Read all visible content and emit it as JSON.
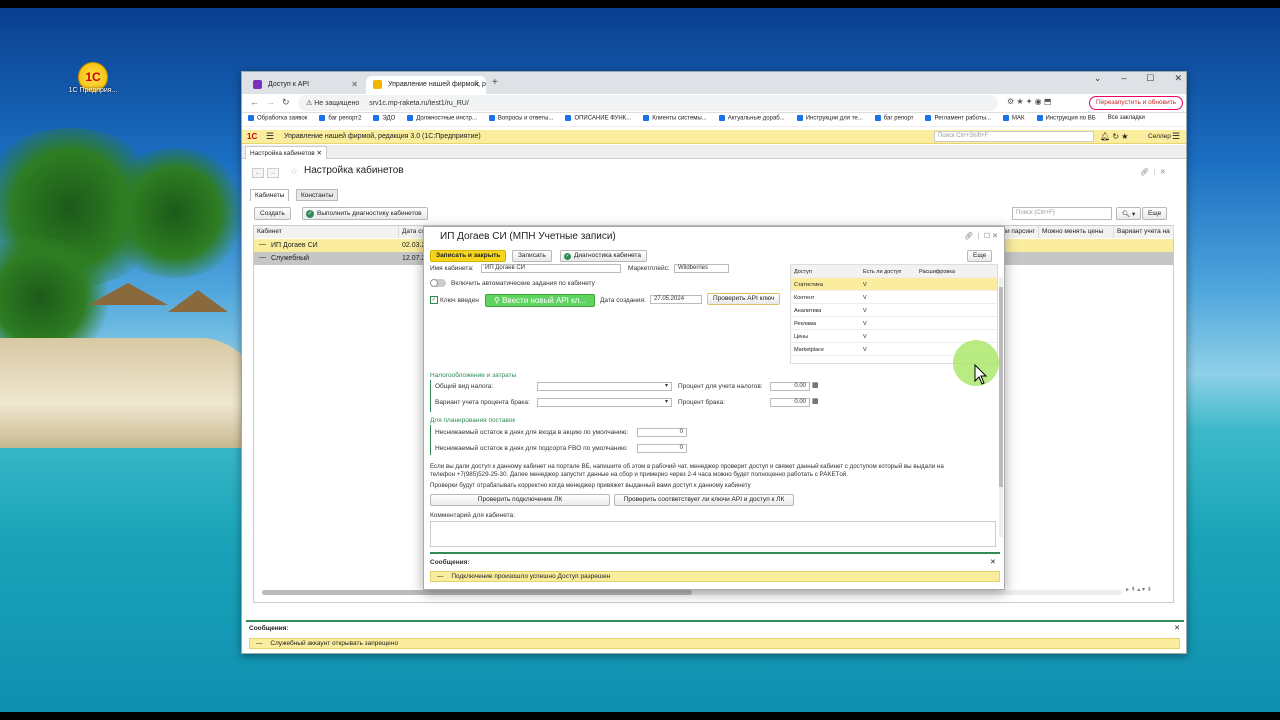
{
  "desktop": {
    "icon_label": "1С Предприя..."
  },
  "browser": {
    "tabs": [
      {
        "label": "Доступ к API"
      },
      {
        "label": "Управление нашей фирмой, р"
      }
    ],
    "url": {
      "security": "Не защищено",
      "address": "srv1c.mp-raketa.ru/test1/ru_RU/"
    },
    "restart_label": "Перезапустить и обновить",
    "bookmarks": [
      "Обработка заявок",
      "баг репорт2",
      "ЭДО",
      "Должностные инстр...",
      "Вопросы и ответы...",
      "ОПИСАНИЕ ФУНК...",
      "Клиенты системы...",
      "Актуальные дораб...",
      "Инструкции для те...",
      "баг репорт",
      "Регламент работы...",
      "МАК",
      "Инструкция по ВБ"
    ],
    "all_bookmarks": "Все закладки"
  },
  "app": {
    "title": "Управление нашей фирмой, редакция 3.0  (1С:Предприятие)",
    "search_placeholder": "Поиск Ctrl+Shift+F",
    "user": "Селлер",
    "open_tab": "Настройка кабинетов",
    "page_title": "Настройка кабинетов",
    "tabs": [
      "Кабинеты",
      "Константы"
    ],
    "create_label": "Создать",
    "diag_label": "Выполнить диагностику кабинетов",
    "search_field": "Поиск (Ctrl+F)",
    "more_label": "Еще",
    "grid": {
      "headers": [
        "Кабинет",
        "Дата со",
        "ли парсинг",
        "Можно менять цены",
        "Вариант учета на"
      ],
      "rows": [
        {
          "name": "ИП Догаев СИ",
          "date": "02.03.2"
        },
        {
          "name": "Служебный",
          "date": "12.07.2"
        }
      ]
    },
    "messages_title": "Сообщения:",
    "message": "Служебный аккаунт открывать запрещено"
  },
  "dialog": {
    "title": "ИП Догаев СИ (МПН Учетные записи)",
    "save_close": "Записать и закрыть",
    "save": "Записать",
    "diag": "Диагностика кабинета",
    "more": "Еще",
    "name_label": "Имя кабинета:",
    "name_value": "ИП Догаев СИ",
    "market_label": "Маркетплейс:",
    "market_value": "Wildberries",
    "auto_tasks": "Включить автоматические задания по кабинету",
    "key_entered": "Ключ введен",
    "new_key": "Ввести новый API кл...",
    "created_label": "Дата создания:",
    "created_value": "27.05.2024",
    "check_key": "Проверить API ключ",
    "access_table": {
      "headers": [
        "Доступ",
        "Есть ли доступ",
        "Расшифровка"
      ],
      "rows": [
        {
          "name": "Статистика",
          "v": "V"
        },
        {
          "name": "Контент",
          "v": "V"
        },
        {
          "name": "Аналитика",
          "v": "V"
        },
        {
          "name": "Реклама",
          "v": "V"
        },
        {
          "name": "Цены",
          "v": "V"
        },
        {
          "name": "Marketplace",
          "v": "V"
        }
      ]
    },
    "tax_section": "Налогообложение и затраты",
    "tax_type_label": "Общий вид налога:",
    "tax_percent_label": "Процент для учета налогов:",
    "tax_percent_value": "0.00",
    "defect_variant_label": "Вариант учета процента брака:",
    "defect_percent_label": "Процент брака:",
    "defect_percent_value": "0.00",
    "plan_section": "Для планирования поставок",
    "min_action_label": "Неснижаемый остаток в днях для входа в акцию по умолчанию:",
    "min_action_value": "0",
    "min_fbo_label": "Неснижаемый остаток в днях для подсорта FBO по умолчанию:",
    "min_fbo_value": "0",
    "info1": "Если вы дали доступ к данному кабинет на портале ВБ, напишите об этом в рабочий чат, менеджер проверит доступ и свяжет данный кабинет с доступом который вы выдали на",
    "info2": "телефон +7(985)529-25-30. Далее менеджер запустит данные на сбор и примерно через 2-4 часа можно будет полноценно работать с PAKETой.",
    "info3": "Проверки будут отрабатывать корректно когда менеджер привяжет выданный вами доступ к данному кабинету",
    "check_lk": "Проверить подключение ЛК",
    "check_match": "Проверить соответствует ли ключи API и доступ к ЛК",
    "comment_label": "Комментарий для кабинета:",
    "messages_title": "Сообщения:",
    "message": "Подключение произошло успешно Доступ разрешен"
  },
  "colors": {
    "accent_yellow": "#fbed9e",
    "green": "#2e8b57",
    "key_button": "#5fd35f"
  }
}
